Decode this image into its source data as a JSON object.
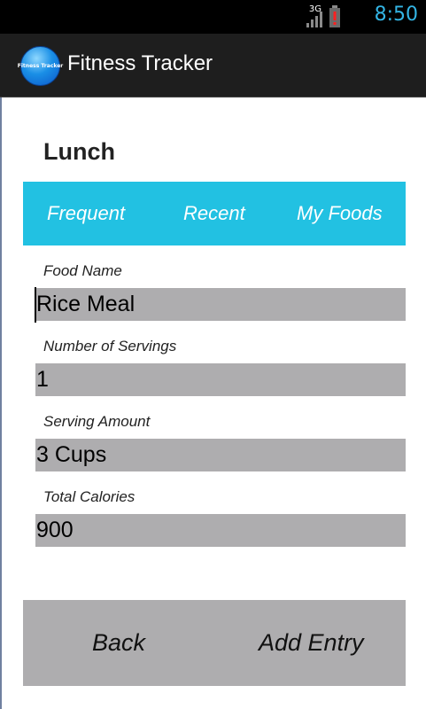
{
  "status_bar": {
    "network_label": "3G",
    "time": "8:50",
    "icons": [
      "signal-icon",
      "battery-alert-icon"
    ]
  },
  "action_bar": {
    "logo_text": "Fitness Tracker",
    "title": "Fitness Tracker"
  },
  "section": {
    "title": "Lunch"
  },
  "tabs": [
    {
      "label": "Frequent"
    },
    {
      "label": "Recent"
    },
    {
      "label": "My Foods"
    }
  ],
  "form": {
    "food_name": {
      "label": "Food Name",
      "value": "Rice Meal"
    },
    "servings": {
      "label": "Number of Servings",
      "value": "1"
    },
    "serving_amount": {
      "label": "Serving Amount",
      "value": "3 Cups"
    },
    "total_calories": {
      "label": "Total Calories",
      "value": "900"
    }
  },
  "buttons": {
    "back_label": "Back",
    "add_entry_label": "Add Entry"
  },
  "colors": {
    "status_time": "#33b5e5",
    "tab_bar": "#22c1e2",
    "field_bg": "#aeadaf",
    "action_bar": "#1e1e1e"
  }
}
